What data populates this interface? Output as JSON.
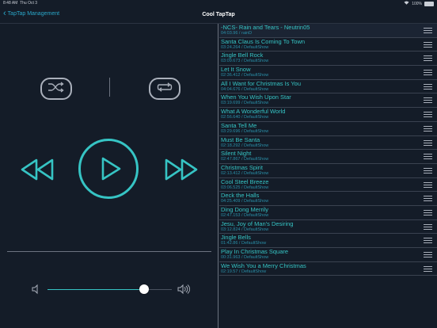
{
  "status": {
    "time": "8:48 AM",
    "date": "Thu Oct 3",
    "battery": "100%"
  },
  "nav": {
    "back_label": "TapTap Management",
    "title": "Cool TapTap"
  },
  "player": {
    "shuffle_icon": "shuffle-icon",
    "repeat_icon": "repeat-icon",
    "rewind_icon": "rewind-icon",
    "play_icon": "play-icon",
    "forward_icon": "fast-forward-icon",
    "volume_level": 0.78,
    "accent": "#36c4c4"
  },
  "tracks": [
    {
      "title": "-NCS- Rain and Tears - Neutrin05",
      "sub": "04:03.96 / rainD"
    },
    {
      "title": "Santa Claus Is Coming To Town",
      "sub": "03:24.264 / DefaultShow"
    },
    {
      "title": "Jingle Bell Rock",
      "sub": "03:09.673 / DefaultShow"
    },
    {
      "title": "Let It Snow",
      "sub": "02:36.412 / DefaultShow"
    },
    {
      "title": "All I Want for Christmas Is You",
      "sub": "04:04.676 / DefaultShow"
    },
    {
      "title": "When You Wish Upon Star",
      "sub": "03:19.699 / DefaultShow"
    },
    {
      "title": "What A Wonderful World",
      "sub": "02:56.640 / DefaultShow"
    },
    {
      "title": "Santa Tell Me",
      "sub": "03:29.696 / DefaultShow"
    },
    {
      "title": "Must Be Santa",
      "sub": "02:18.292 / DefaultShow"
    },
    {
      "title": "Silent Night",
      "sub": "02:47.867 / DefaultShow"
    },
    {
      "title": "Christmas Spirit",
      "sub": "02:13.412 / DefaultShow"
    },
    {
      "title": "Cool Steel Breeze",
      "sub": "03:06.525 / DefaultShow"
    },
    {
      "title": "Deck the Halls",
      "sub": "04:25.409 / DefaultShow"
    },
    {
      "title": "Ding Dong Merrily",
      "sub": "02:47.153 / DefaultShow"
    },
    {
      "title": "Jesu, Joy of Man's Desiring",
      "sub": "03:12.824 / DefaultShow"
    },
    {
      "title": "Jingle Bells",
      "sub": "01:42.86 / DefaultShow"
    },
    {
      "title": "Play In Christmas Square",
      "sub": "00:31.963 / DefaultShow"
    },
    {
      "title": "We Wish You a Merry Christmas",
      "sub": "02:19.57 / DefaultShow"
    }
  ]
}
